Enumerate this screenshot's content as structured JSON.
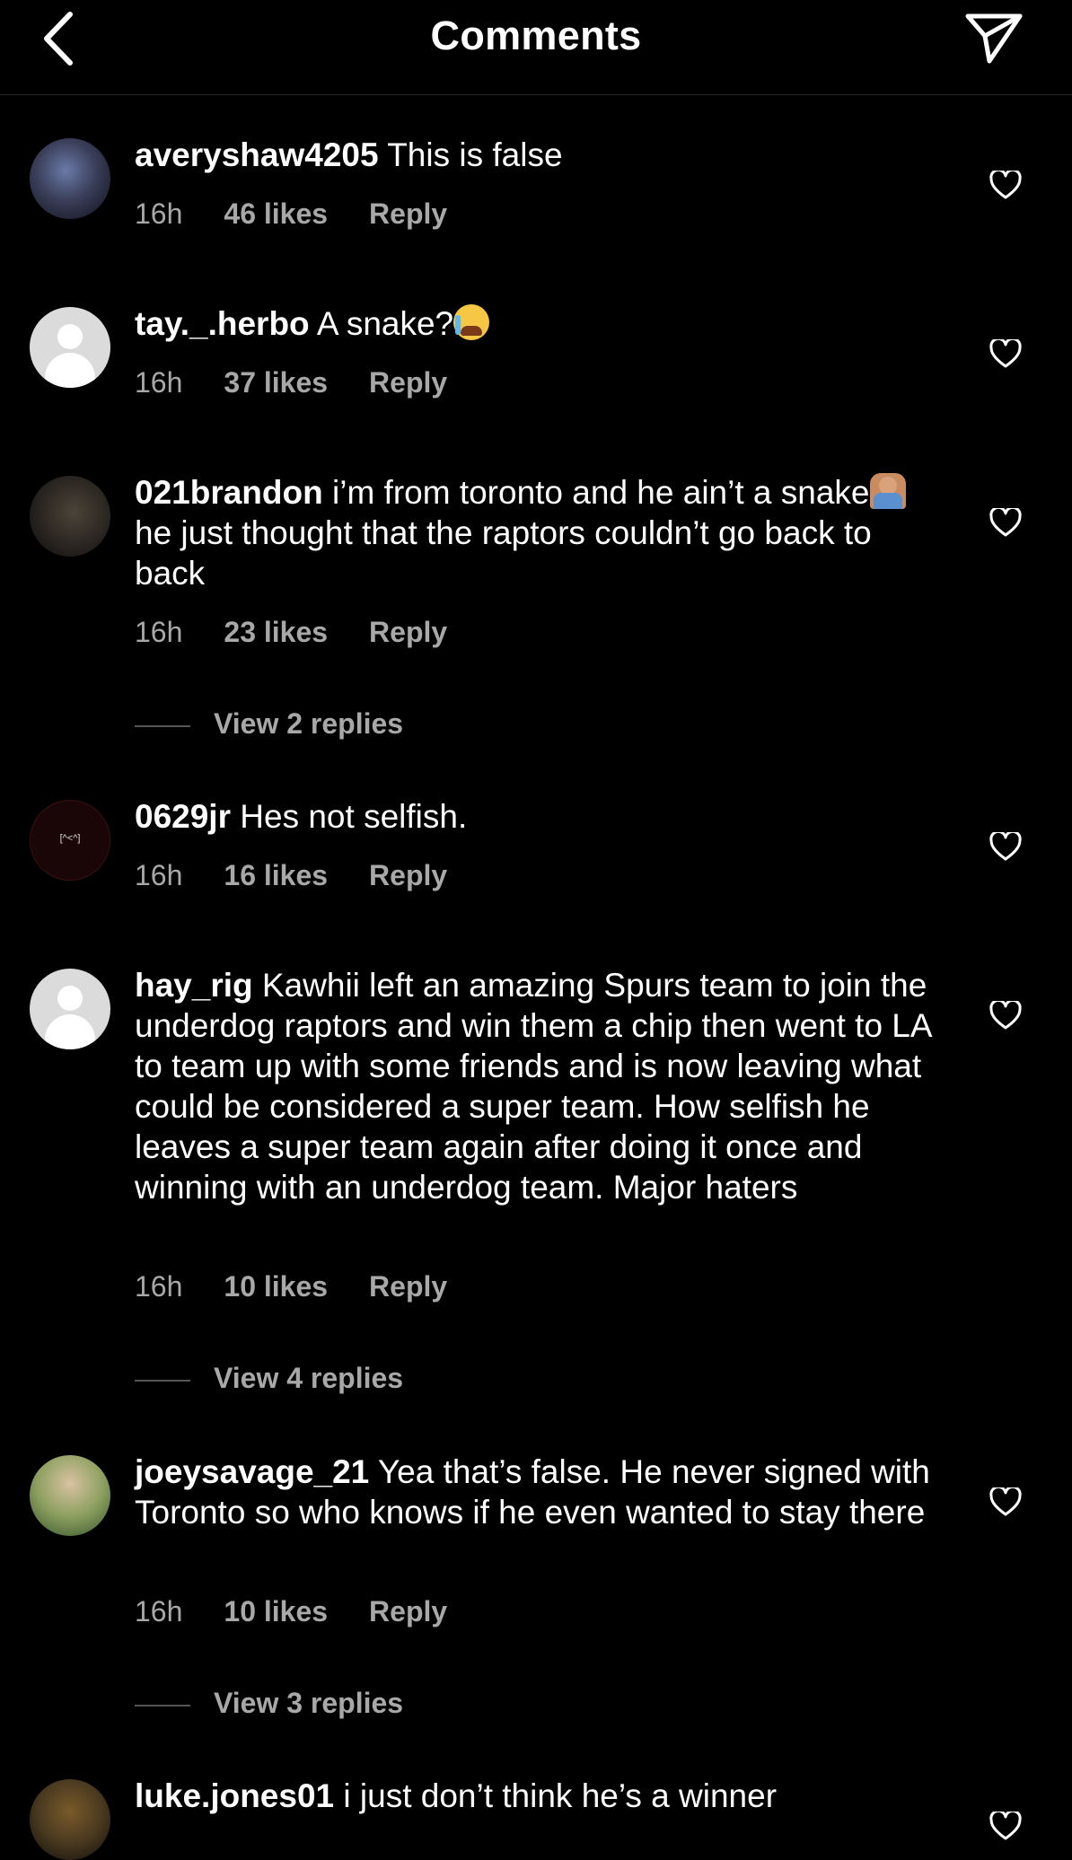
{
  "header": {
    "title": "Comments"
  },
  "comments": [
    {
      "username": "averyshaw4205",
      "text": "This is false",
      "time": "16h",
      "likes": "46 likes",
      "reply": "Reply"
    },
    {
      "username": "tay._.herbo",
      "text": "A snake?",
      "time": "16h",
      "likes": "37 likes",
      "reply": "Reply"
    },
    {
      "username": "021brandon",
      "text": "i’m from toronto and he ain’t a snake",
      "text2": " he just thought that the raptors couldn’t go back to back",
      "time": "16h",
      "likes": "23 likes",
      "reply": "Reply",
      "view_replies": "View 2 replies"
    },
    {
      "username": "0629jr",
      "avatar_text": "[^<^]",
      "text": "Hes not selfish.",
      "time": "16h",
      "likes": "16 likes",
      "reply": "Reply"
    },
    {
      "username": "hay_rig",
      "text": "Kawhii left an amazing Spurs team to join the underdog raptors and win them a chip then went to LA to team up with some friends and is now leaving what could be considered a super team. How selfish he leaves a super team again after doing it once and winning with an underdog team. Major haters",
      "time": "16h",
      "likes": "10 likes",
      "reply": "Reply",
      "view_replies": "View 4 replies"
    },
    {
      "username": "joeysavage_21",
      "text": "Yea that’s false. He never signed with Toronto so who knows if he even wanted to stay there",
      "time": "16h",
      "likes": "10 likes",
      "reply": "Reply",
      "view_replies": "View 3 replies"
    },
    {
      "username": "luke.jones01",
      "text": "i just don’t think he’s a winner"
    }
  ]
}
